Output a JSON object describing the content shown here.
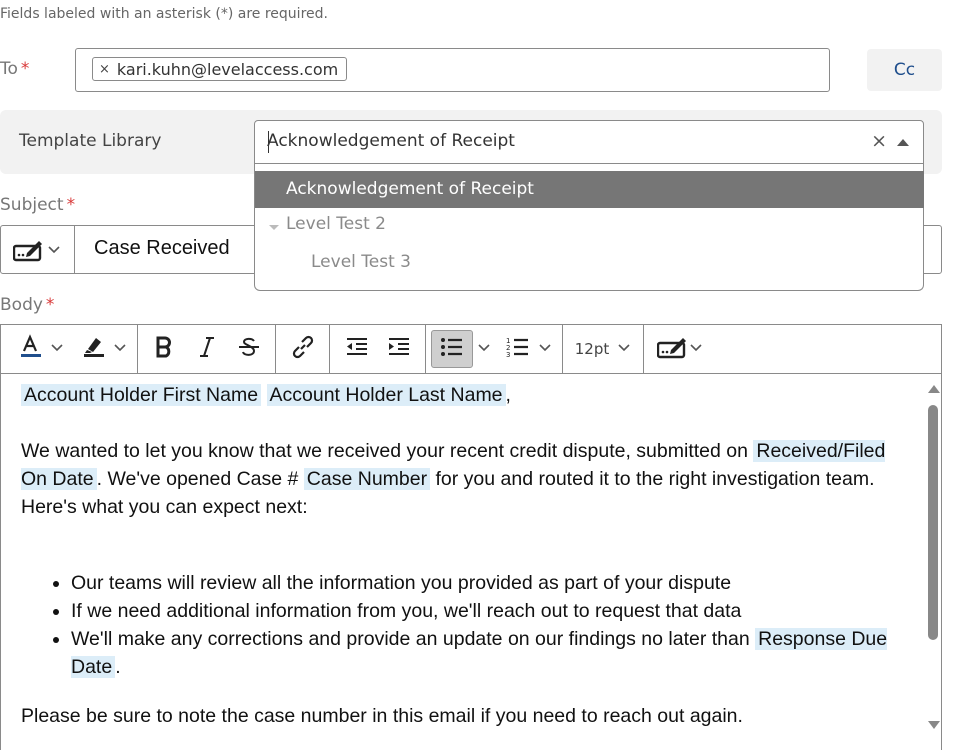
{
  "form": {
    "required_note": "Fields labeled with an asterisk (*) are required.",
    "required_marker": "*"
  },
  "to": {
    "label": "To",
    "recipient": "kari.kuhn@levelaccess.com",
    "remove_symbol": "×"
  },
  "cc": {
    "label": "Cc"
  },
  "template_library": {
    "label": "Template Library",
    "value": "Acknowledgement of Receipt",
    "clear_symbol": "×",
    "options": [
      "Acknowledgement of Receipt",
      "Level Test 2",
      "Level Test 3"
    ],
    "highlighted_option": 0
  },
  "subject": {
    "label": "Subject",
    "value": "Case Received"
  },
  "body": {
    "label": "Body",
    "toolbar": {
      "font_size": "12pt",
      "icons": [
        "font-color-icon",
        "highlight-color-icon",
        "bold-icon",
        "italic-icon",
        "strikethrough-icon",
        "link-icon",
        "outdent-icon",
        "indent-icon",
        "bulleted-list-icon",
        "numbered-list-icon",
        "insert-field-icon"
      ]
    },
    "content": {
      "greeting_token1": "Account Holder First Name",
      "greeting_token2": "Account Holder Last Name",
      "greeting_punct": ",",
      "para1_text1": "We wanted to let you know that we received your recent credit dispute, submitted on ",
      "para1_token1": "Received/Filed On Date",
      "para1_text2": ". We've opened Case # ",
      "para1_token2": "Case Number",
      "para1_text3": " for you and routed it to the right investigation team. Here's what you can expect next:",
      "bullet1": "Our teams will review all the information you provided as part of your dispute",
      "bullet2": "If we need additional information from you, we'll reach out to request that data",
      "bullet3_text": "We'll make any corrections and provide an update on our findings no later than ",
      "bullet3_token": "Response Due Date",
      "bullet3_end": ".",
      "closing": "Please be sure to note the case number in this email if you need to reach out again."
    }
  },
  "colors": {
    "required": "#d93a3a",
    "token_highlight": "#dcedf8",
    "dropdown_selected": "#767676",
    "cc_text": "#1f4e8c"
  }
}
